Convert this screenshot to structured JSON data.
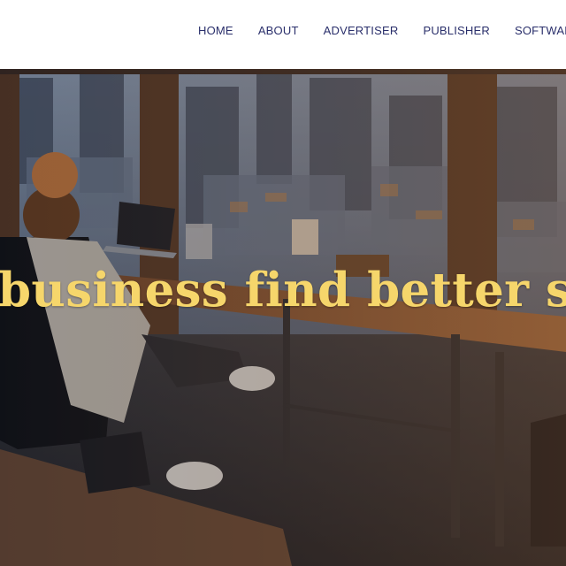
{
  "nav": {
    "items": [
      {
        "label": "HOME"
      },
      {
        "label": "ABOUT"
      },
      {
        "label": "ADVERTISER"
      },
      {
        "label": "PUBLISHER"
      },
      {
        "label": "SOFTWARE S"
      }
    ]
  },
  "hero": {
    "headline": "business find better sol",
    "image": "office-with-city-view-photo"
  },
  "colors": {
    "nav_text": "#2a2f6b",
    "headline": "#f6d66b"
  }
}
